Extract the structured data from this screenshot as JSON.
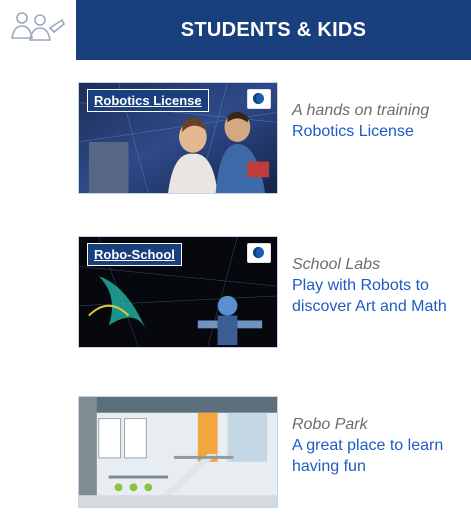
{
  "header": {
    "title": "STUDENTS & KIDS",
    "icon": "students-icon",
    "bar_color": "#1a3f7d"
  },
  "cards": [
    {
      "label": "Robotics License",
      "lead": "A hands on training",
      "link": "Robotics License"
    },
    {
      "label": "Robo-School",
      "lead": "School Labs",
      "link": "Play with Robots to discover Art and Math"
    },
    {
      "label": "",
      "lead": "Robo Park",
      "link": "A great place to learn having fun"
    }
  ],
  "colors": {
    "lead_text": "#6d6d6d",
    "link_text": "#1e5bc6"
  }
}
